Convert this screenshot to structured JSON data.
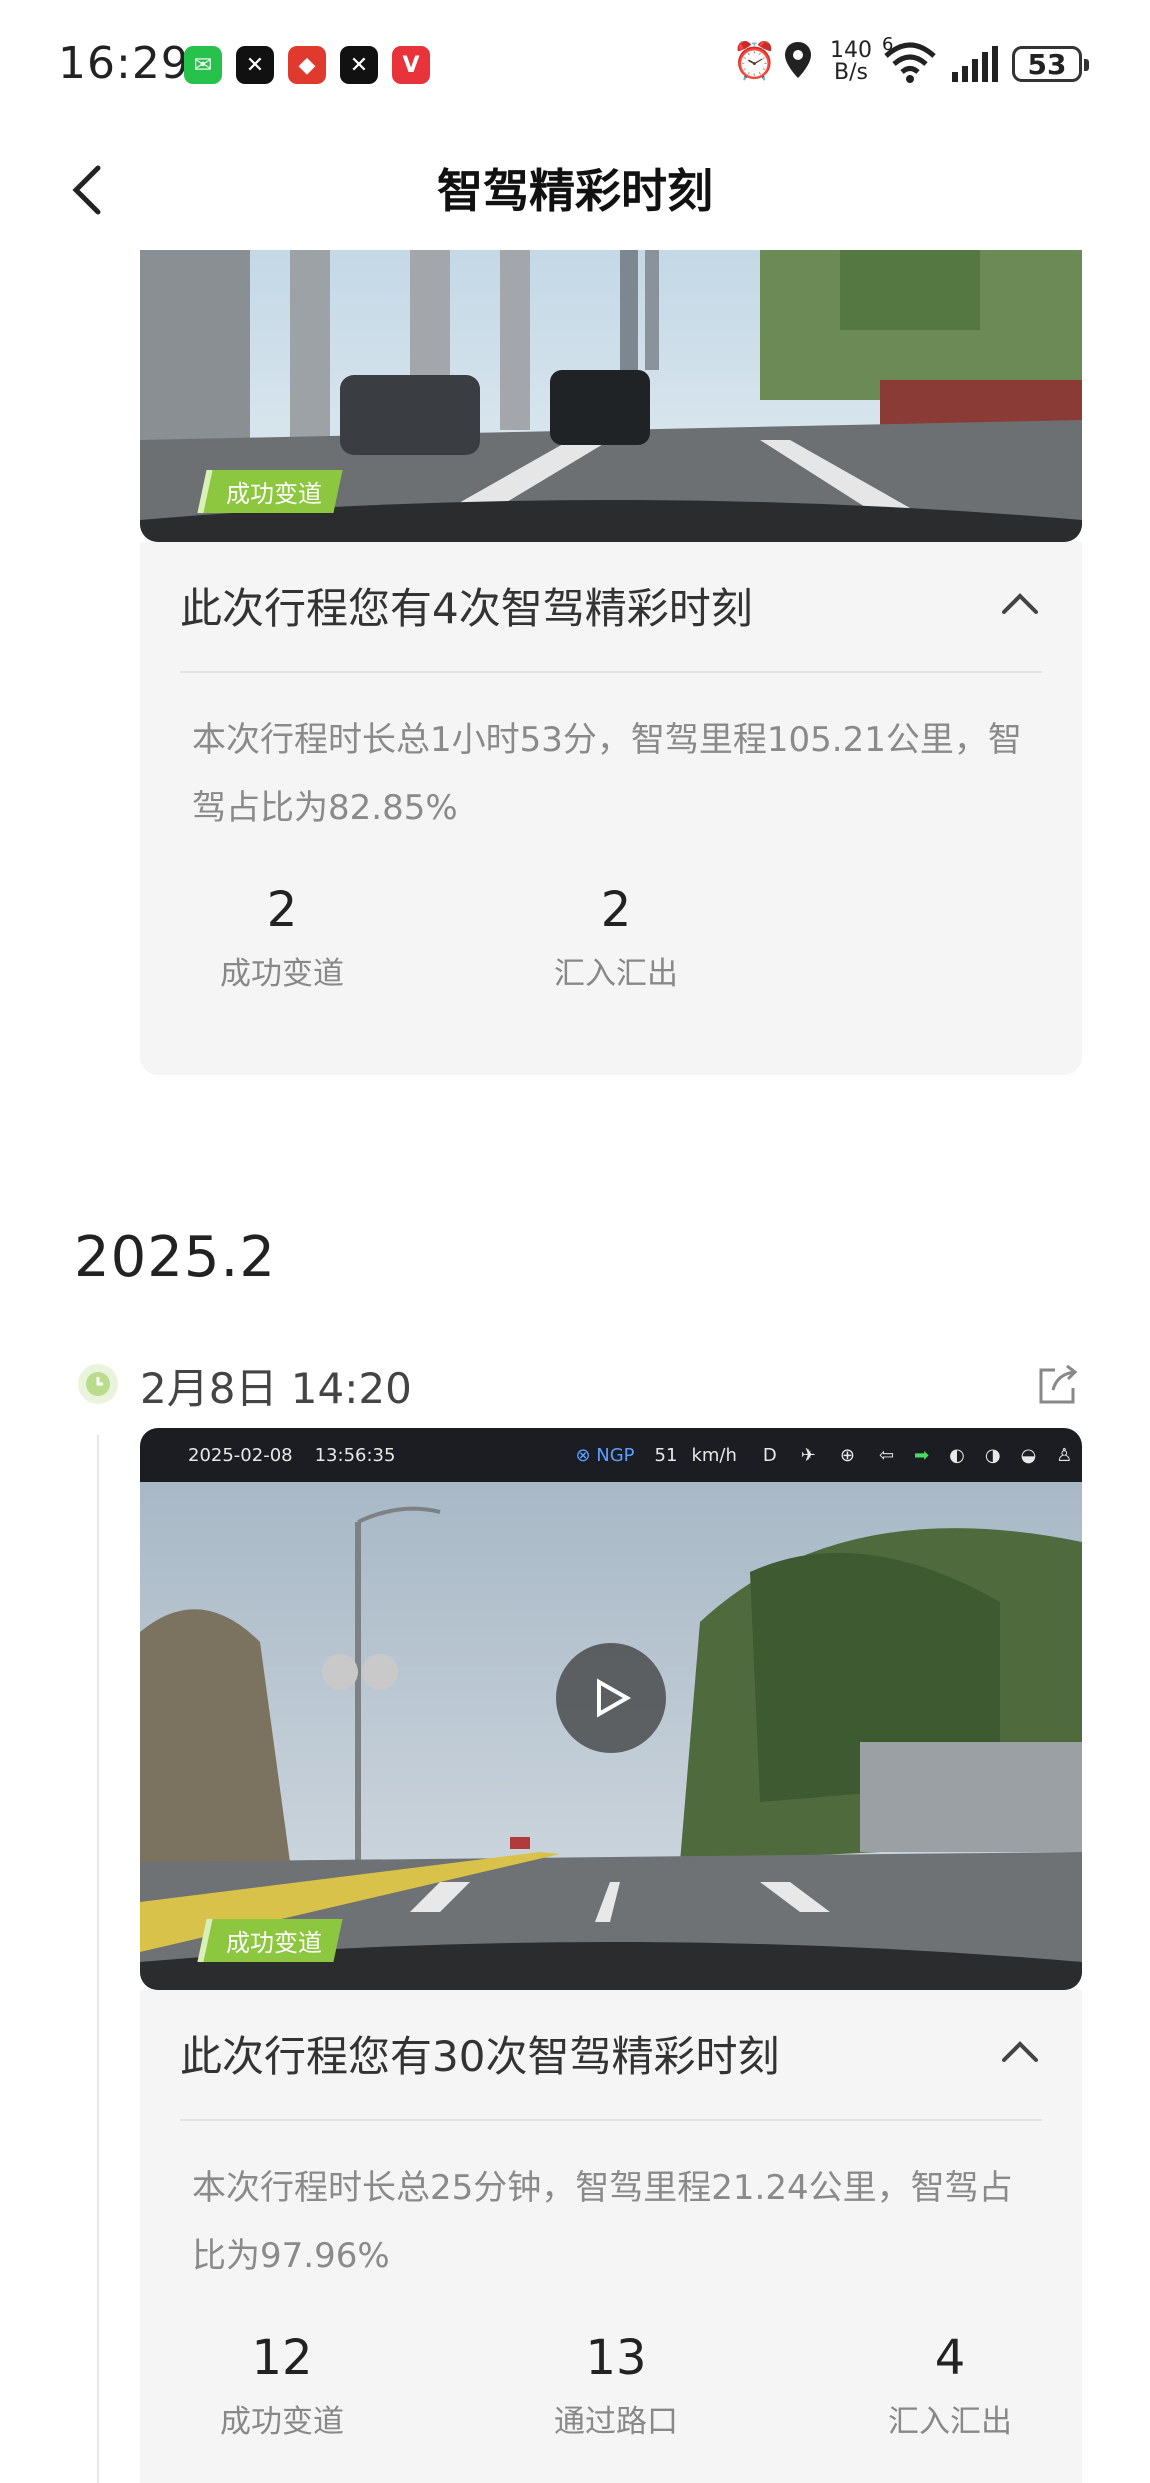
{
  "status_bar": {
    "time": "16:29",
    "net_speed_value": "140",
    "net_speed_unit": "B/s",
    "signal_label": "6",
    "battery": "53"
  },
  "header": {
    "title": "智驾精彩时刻"
  },
  "trip1": {
    "badge": "成功变道",
    "heading": "此次行程您有4次智驾精彩时刻",
    "summary": "本次行程时长总1小时53分，智驾里程105.21公里，智驾占比为82.85%",
    "stats": [
      {
        "value": "2",
        "label": "成功变道"
      },
      {
        "value": "2",
        "label": "汇入汇出"
      }
    ]
  },
  "year_label": "2025.2",
  "trip2": {
    "date": "2月8日 14:20",
    "video": {
      "date": "2025-02-08",
      "time": "13:56:35",
      "mode": "NGP",
      "speed": "51",
      "speed_unit": "km/h",
      "gear": "D"
    },
    "badge": "成功变道",
    "heading": "此次行程您有30次智驾精彩时刻",
    "summary": "本次行程时长总25分钟，智驾里程21.24公里，智驾占比为97.96%",
    "stats": [
      {
        "value": "12",
        "label": "成功变道"
      },
      {
        "value": "13",
        "label": "通过路口"
      },
      {
        "value": "4",
        "label": "汇入汇出"
      }
    ]
  },
  "colors": {
    "accent_green": "#8dc63f",
    "card_bg": "#f5f5f5",
    "text_muted": "#8a8a8a"
  }
}
